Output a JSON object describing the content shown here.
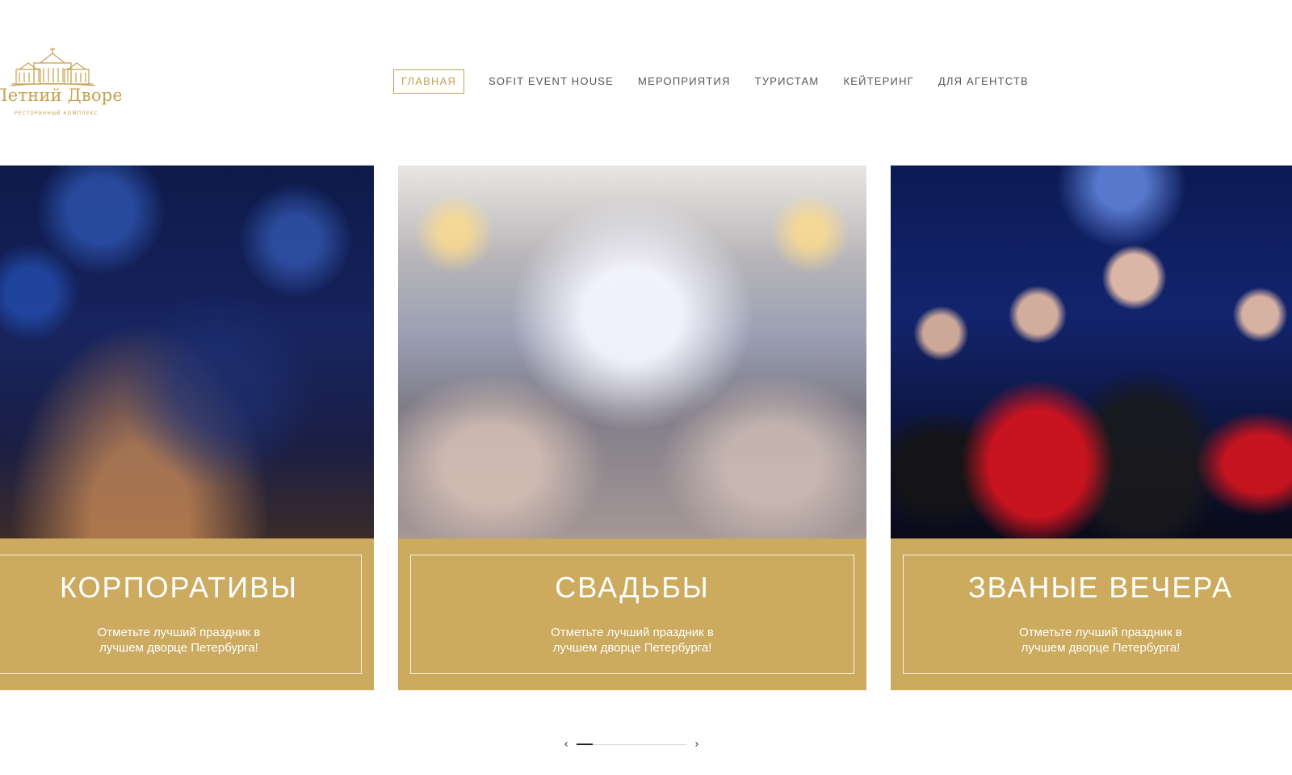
{
  "header": {
    "logo_name": "Летний Дворец",
    "logo_sub": "РЕСТОРАННЫЙ КОМПЛЕКС",
    "nav": [
      {
        "label": "ГЛАВНАЯ",
        "active": true
      },
      {
        "label": "SOFIT EVENT HOUSE",
        "active": false
      },
      {
        "label": "МЕРОПРИЯТИЯ",
        "active": false
      },
      {
        "label": "ТУРИСТАМ",
        "active": false
      },
      {
        "label": "КЕЙТЕРИНГ",
        "active": false
      },
      {
        "label": "ДЛЯ АГЕНТСТВ",
        "active": false
      }
    ]
  },
  "carousel": {
    "cards": [
      {
        "title": "КОРПОРАТИВЫ",
        "text": "Отметьте лучший праздник в лучшем дворце Петербурга!"
      },
      {
        "title": "СВАДЬБЫ",
        "text": "Отметьте лучший праздник в лучшем дворце Петербурга!"
      },
      {
        "title": "ЗВАНЫЕ ВЕЧЕРА",
        "text": "Отметьте лучший праздник в лучшем дворце Петербурга!"
      }
    ],
    "pager": {
      "prev_icon": "chevron-left-icon",
      "next_icon": "chevron-right-icon",
      "progress": 0.15
    }
  },
  "colors": {
    "accent": "#c5a04e",
    "caption_bg": "#c8a452",
    "nav_text": "#555555"
  }
}
